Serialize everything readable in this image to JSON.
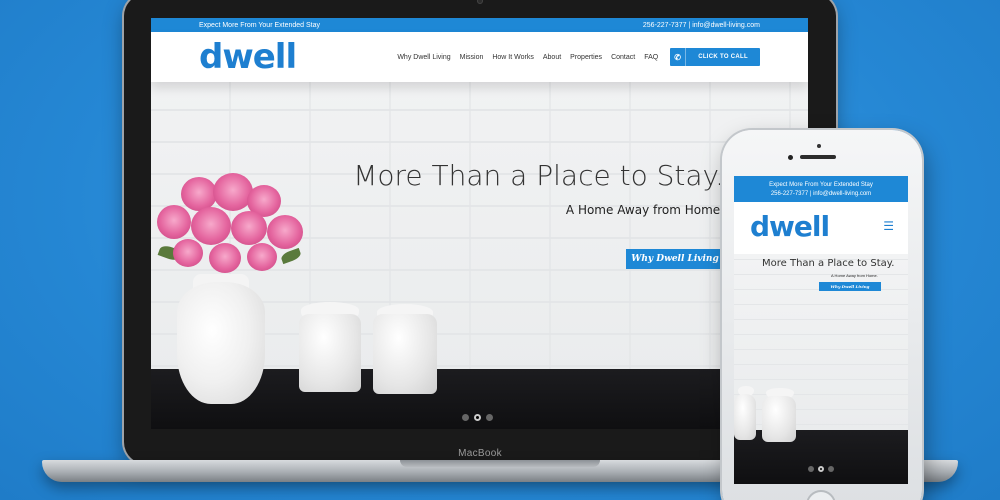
{
  "site": {
    "tagline": "Expect More From Your Extended Stay",
    "contact": "256-227-7377  |  info@dwell-living.com",
    "contact_phone_mobile": "256-227-7377  |  info@dwell-living.com",
    "logo": "dwell",
    "nav": [
      "Why Dwell Living",
      "Mission",
      "How It Works",
      "About",
      "Properties",
      "Contact",
      "FAQ"
    ],
    "cta_label": "CLICK TO CALL",
    "hero_title": "More Than a Place to Stay.",
    "hero_subtitle": "A Home Away from Home.",
    "hero_button": "Why Dwell Living",
    "slider_dots": 3,
    "active_dot": 2
  },
  "device": {
    "laptop_label": "MacBook"
  },
  "icons": {
    "phone": "phone-icon",
    "menu": "hamburger-menu-icon"
  },
  "colors": {
    "brand_blue": "#1e88d6",
    "background": "#2a8fdb",
    "logo_blue": "#1e7fd0"
  }
}
